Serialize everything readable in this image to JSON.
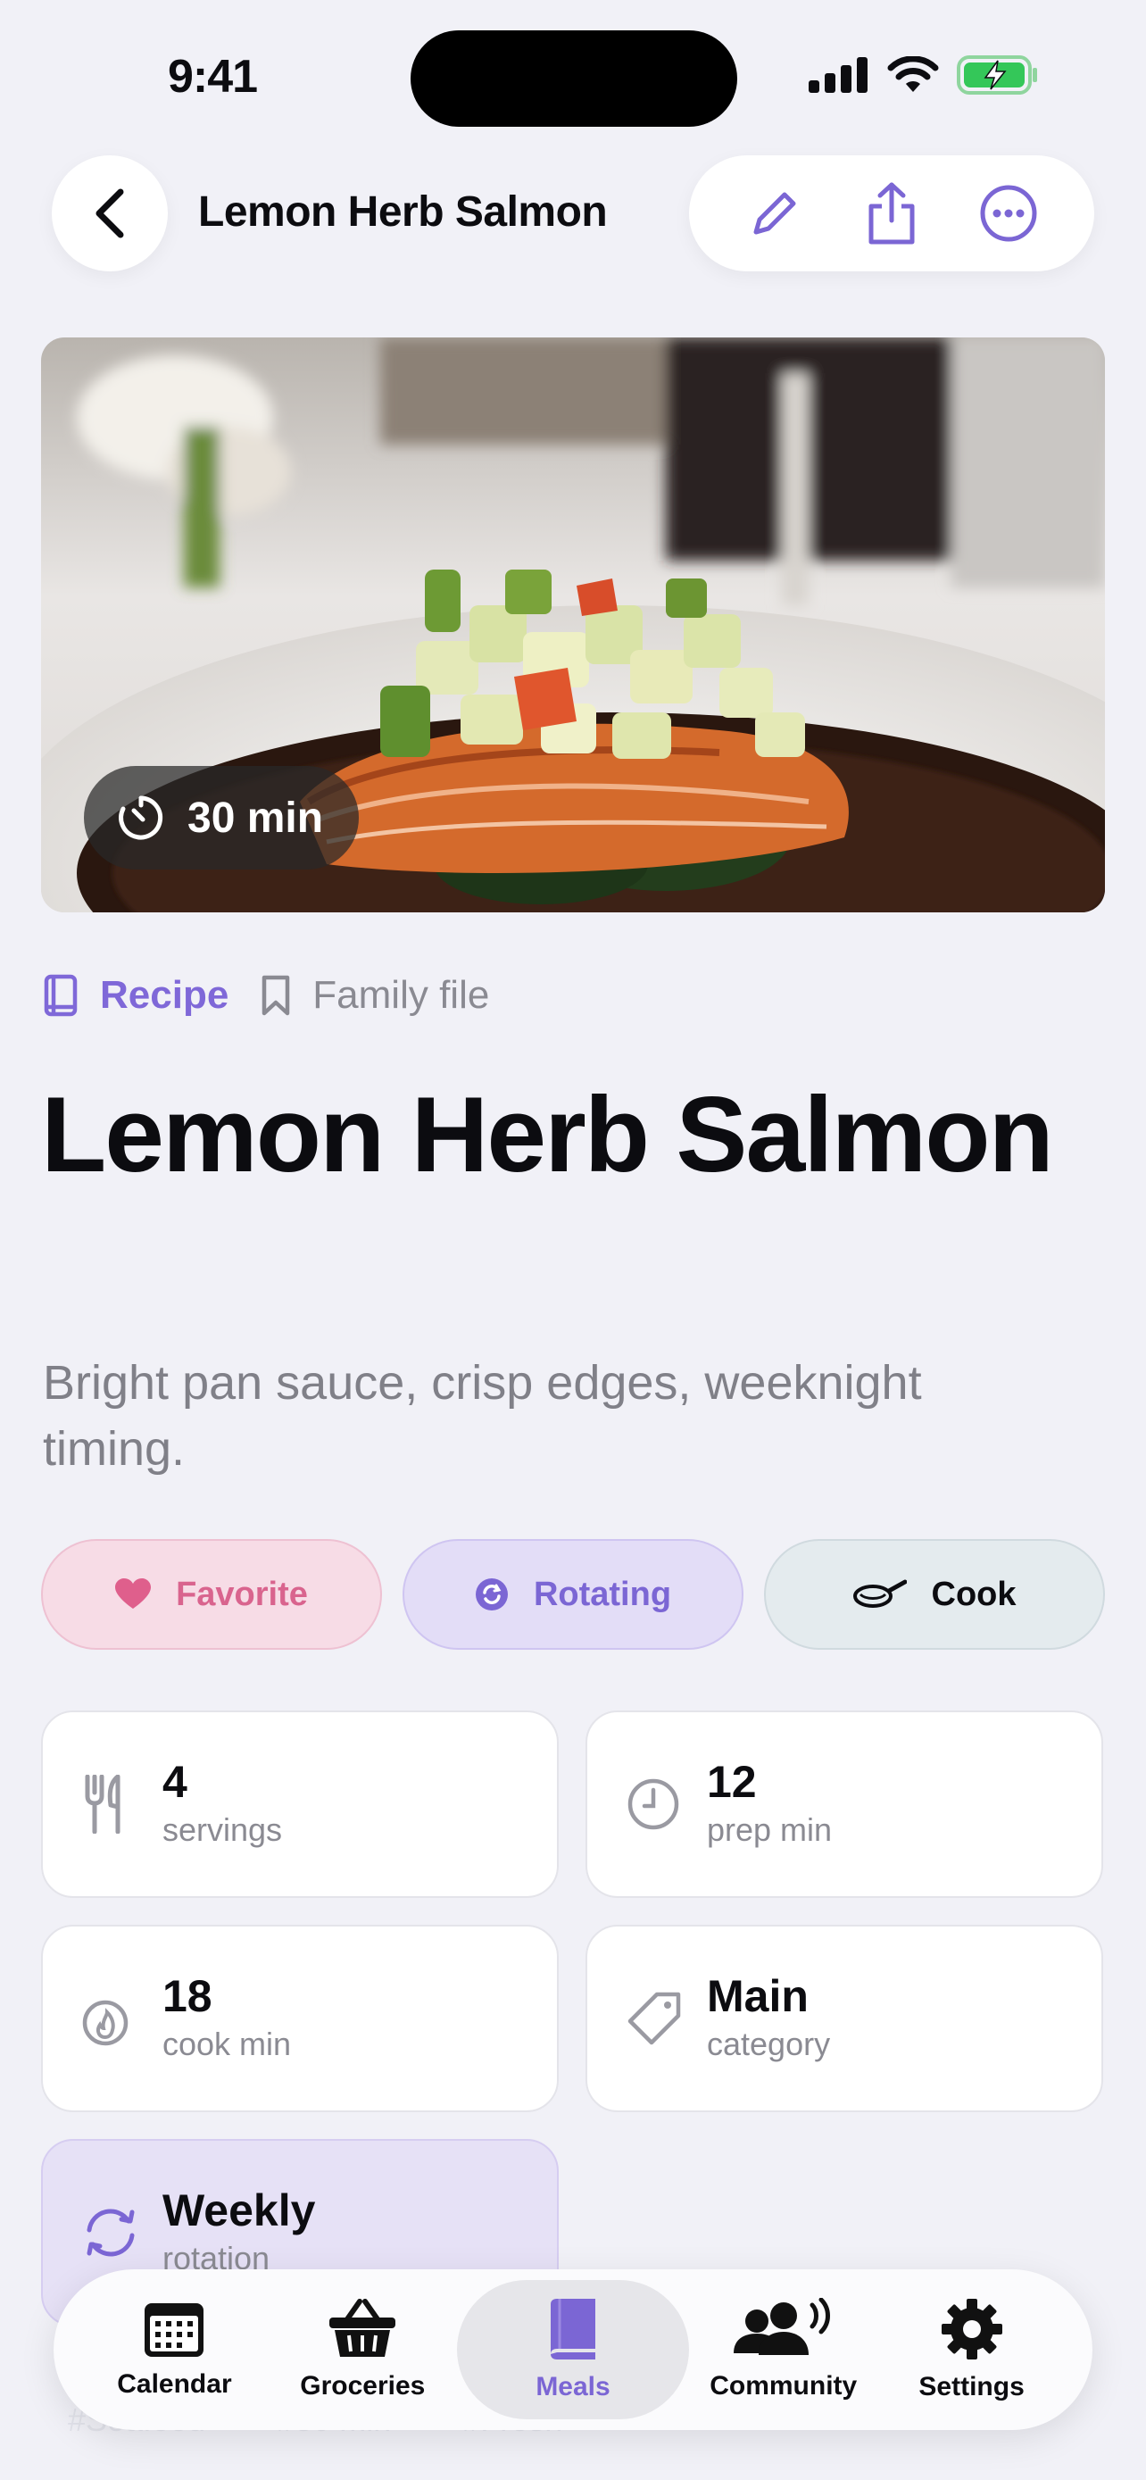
{
  "status": {
    "time": "9:41"
  },
  "nav": {
    "title": "Lemon Herb Salmon"
  },
  "hero": {
    "time_badge": "30 min"
  },
  "meta": {
    "type_label": "Recipe",
    "collection_label": "Family file"
  },
  "recipe": {
    "title": "Lemon Herb Salmon",
    "subtitle": "Bright pan sauce, crisp edges, weeknight timing."
  },
  "chips": {
    "favorite": "Favorite",
    "rotating": "Rotating",
    "cook": "Cook"
  },
  "stats": [
    {
      "value": "4",
      "label": "servings",
      "icon": "utensils-icon"
    },
    {
      "value": "12",
      "label": "prep min",
      "icon": "clock-icon"
    },
    {
      "value": "18",
      "label": "cook min",
      "icon": "flame-icon"
    },
    {
      "value": "Main",
      "label": "category",
      "icon": "tag-icon"
    },
    {
      "value": "Weekly",
      "label": "rotation",
      "icon": "rotate-icon"
    }
  ],
  "tags": [
    "#Seafood",
    "#30 min",
    "#Fresh"
  ],
  "tabs": [
    {
      "label": "Calendar",
      "icon": "calendar-icon",
      "active": false
    },
    {
      "label": "Groceries",
      "icon": "basket-icon",
      "active": false
    },
    {
      "label": "Meals",
      "icon": "book-icon",
      "active": true
    },
    {
      "label": "Community",
      "icon": "people-icon",
      "active": false
    },
    {
      "label": "Settings",
      "icon": "gear-icon",
      "active": false
    }
  ],
  "colors": {
    "accent": "#7b66d4",
    "favorite": "#d9648e",
    "background": "#f1f1f7",
    "battery": "#34c759"
  }
}
